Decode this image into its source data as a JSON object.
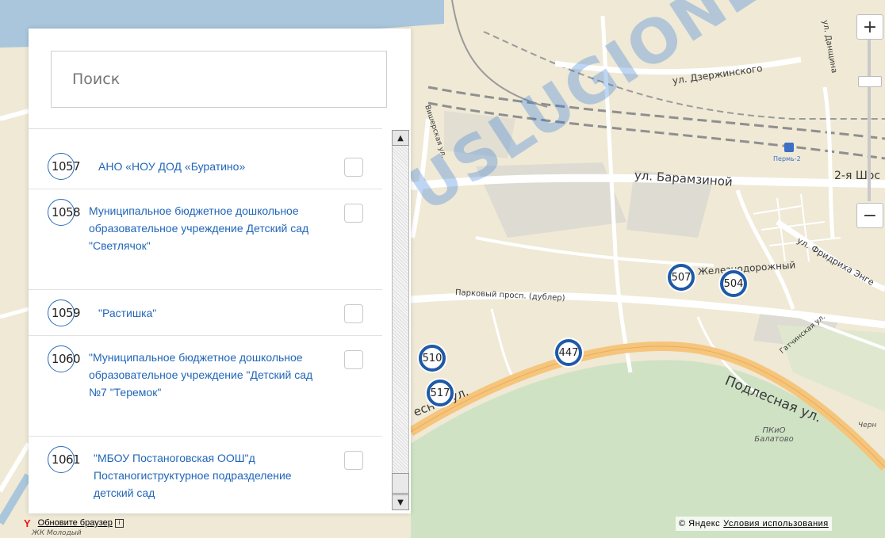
{
  "search": {
    "placeholder": "Поиск"
  },
  "list": {
    "items": [
      {
        "num": "1057",
        "title": "АНО «НОУ ДОД «Буратино»"
      },
      {
        "num": "1058",
        "title": "Муниципальное бюджетное дошкольное образовательное учреждение Детский сад \"Светлячок\""
      },
      {
        "num": "1059",
        "title": "\"Растишка\""
      },
      {
        "num": "1060",
        "title": "\"Муниципальное бюджетное дошкольное образовательное учреждение \"Детский сад №7 \"Теремок\""
      },
      {
        "num": "1061",
        "title": "\"МБОУ Постаноговская ООШ\"д Постаногиструктурное подразделение детский сад"
      }
    ]
  },
  "map": {
    "streets": [
      "ул. Дзержинского",
      "ул. Барамзиной",
      "2-я Шос",
      "Парковый просп. (дублер)",
      "ул. Фридриха Энге",
      "Подлесная ул.",
      "есная ул.",
      "ул. Данщина",
      "Вишерская ул.",
      "Гатчинская ул.",
      "Железнодорожный"
    ],
    "pois": [
      "Пермь-2",
      "ПКиО Балатово",
      "ЖК Молодый",
      "Черн"
    ],
    "clusters": [
      "507",
      "504",
      "510",
      "447",
      "517"
    ]
  },
  "watermark": "USLUGIONLINE.RU",
  "controls": {
    "zoom_in": "+",
    "zoom_out": "−"
  },
  "footer": {
    "logo": "Y",
    "update_browser": "Обновите браузер",
    "info_box": "i",
    "copyright": "© Яндекс",
    "terms": "Условия использования"
  },
  "colors": {
    "cluster_border": "#1e5aa8",
    "link": "#2166b8",
    "park": "#cfe3c4",
    "major_road": "#f6c57c"
  }
}
